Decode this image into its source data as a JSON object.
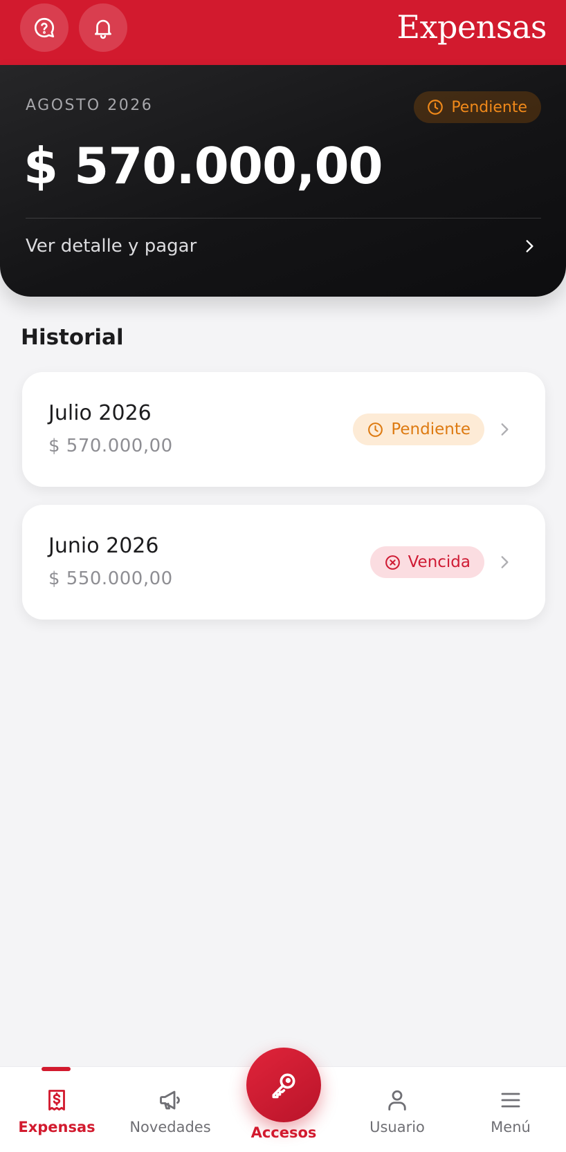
{
  "header": {
    "brand": "Expensas",
    "help_icon": "help-circle-icon",
    "notifications_icon": "bell-icon",
    "color": "#d21a2e"
  },
  "current": {
    "period": "AGOSTO 2026",
    "status": "Pendiente",
    "status_icon": "clock-icon",
    "amount": "$ 570.000,00",
    "action_label": "Ver detalle y pagar"
  },
  "history": {
    "title": "Historial",
    "items": [
      {
        "title": "Julio 2026",
        "amount": "$ 570.000,00",
        "status": "Pendiente",
        "status_icon": "clock-icon",
        "status_color": "#dd7a11"
      },
      {
        "title": "Junio 2026",
        "amount": "$ 550.000,00",
        "status": "Vencida",
        "status_icon": "x-circle-icon",
        "status_color": "#cf1b34"
      }
    ]
  },
  "nav": {
    "items": [
      {
        "label": "Expensas",
        "icon": "receipt-dollar-icon",
        "active": true
      },
      {
        "label": "Novedades",
        "icon": "megaphone-icon",
        "active": false
      },
      {
        "label": "Accesos",
        "icon": "key-icon",
        "active": false
      },
      {
        "label": "Usuario",
        "icon": "user-icon",
        "active": false
      },
      {
        "label": "Menú",
        "icon": "menu-icon",
        "active": false
      }
    ]
  }
}
